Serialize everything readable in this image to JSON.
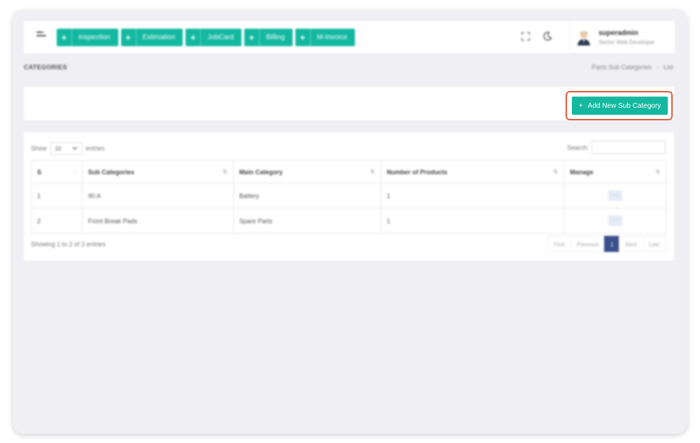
{
  "header": {
    "quick_buttons": [
      {
        "label": "Inspection",
        "icon": "plus-icon"
      },
      {
        "label": "Estimation",
        "icon": "plus-icon"
      },
      {
        "label": "JobCard",
        "icon": "plus-icon"
      },
      {
        "label": "Billing",
        "icon": "plus-icon"
      },
      {
        "label": "M-Invoice",
        "icon": "plus-icon"
      }
    ],
    "plus_symbol": "+",
    "user": {
      "name": "superadmin",
      "role": "Senior Web Developer"
    }
  },
  "page": {
    "title": "CATEGORIES",
    "breadcrumb": {
      "parent": "Parts Sub Categories",
      "separator": "›",
      "current": "List"
    }
  },
  "actions": {
    "add_button_label": "Add New Sub Category",
    "add_button_icon": "+"
  },
  "table_controls": {
    "show_label": "Show",
    "entries_value": "10",
    "entries_label": "entries",
    "search_label": "Search:",
    "search_value": ""
  },
  "table": {
    "columns": [
      "S",
      "Sub Categories",
      "Main Category",
      "Number of Products",
      "Manage"
    ],
    "rows": [
      {
        "s": "1",
        "sub_category": "90 A",
        "main_category": "Battery",
        "products": "1",
        "manage": "···"
      },
      {
        "s": "2",
        "sub_category": "Front Break Pads",
        "main_category": "Spare Parts",
        "products": "1",
        "manage": "···"
      }
    ]
  },
  "footer": {
    "showing_text": "Showing 1 to 2 of 2 entries",
    "pagination": {
      "first": "First",
      "previous": "Previous",
      "current": "1",
      "next": "Next",
      "last": "Last"
    }
  },
  "colors": {
    "accent": "#14b8a0",
    "highlight_border": "#e05a3c",
    "active_page": "#3b4f8c"
  }
}
